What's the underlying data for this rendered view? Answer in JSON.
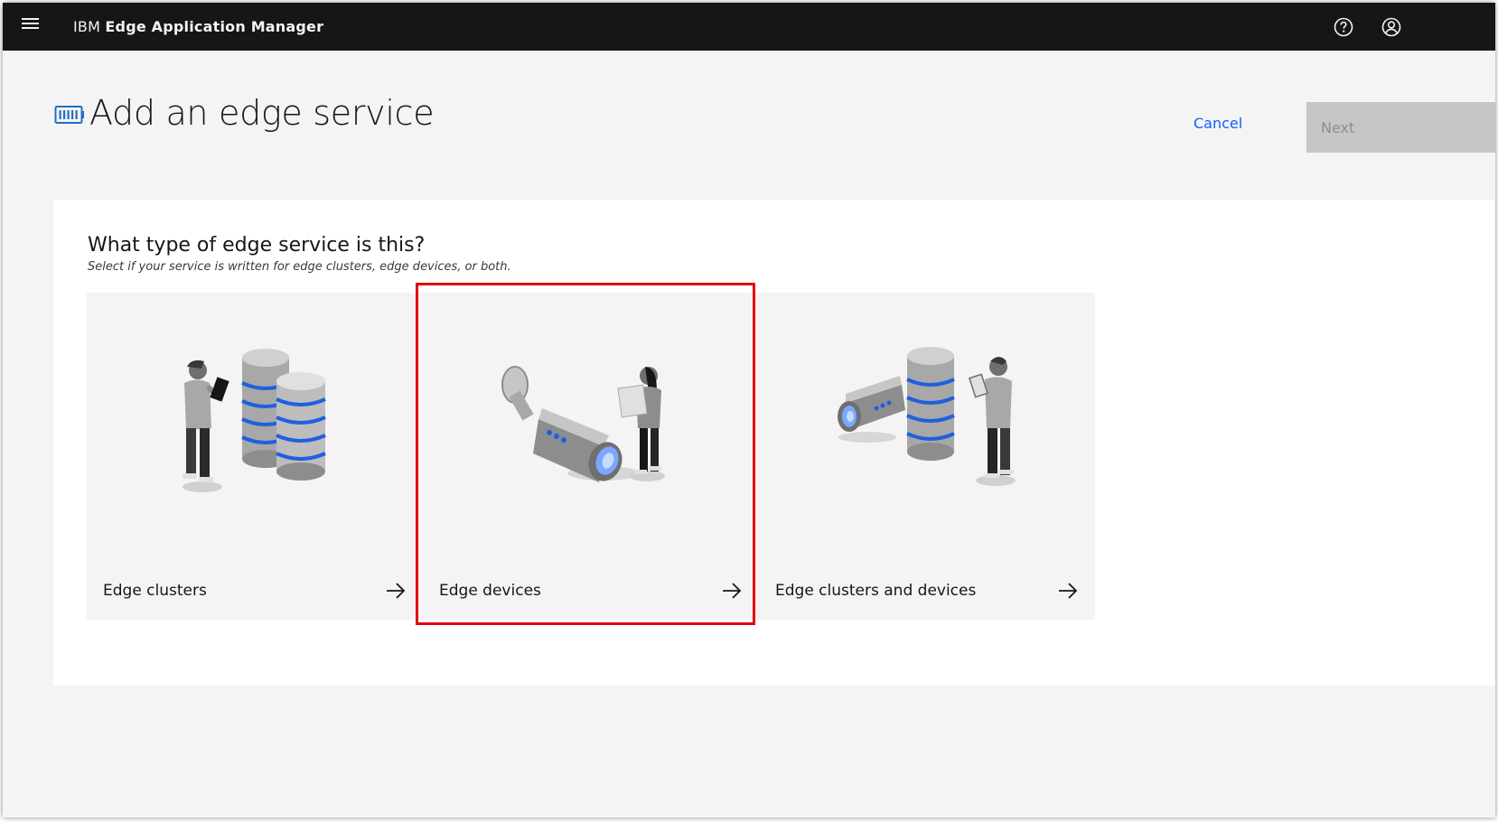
{
  "header": {
    "brand_prefix": "IBM",
    "brand_product": "Edge Application Manager",
    "icons": [
      "menu-icon",
      "help-icon",
      "user-avatar-icon"
    ]
  },
  "page": {
    "title": "Add an edge service",
    "title_icon": "service-icon",
    "cancel_label": "Cancel",
    "next_label": "Next"
  },
  "question": {
    "heading": "What type of edge service is this?",
    "hint": "Select if your service is written for edge clusters, edge devices, or both."
  },
  "tiles": [
    {
      "label": "Edge clusters",
      "illustration": "cluster-illustration"
    },
    {
      "label": "Edge devices",
      "illustration": "device-illustration"
    },
    {
      "label": "Edge clusters and devices",
      "illustration": "cluster-and-device-illustration"
    }
  ],
  "colors": {
    "header_bg": "#161616",
    "page_bg": "#f4f4f4",
    "link_blue": "#0f62fe",
    "disabled_button": "#c6c6c6",
    "highlight_red": "#e4000f",
    "accent_blue": "#1f5fe0"
  }
}
